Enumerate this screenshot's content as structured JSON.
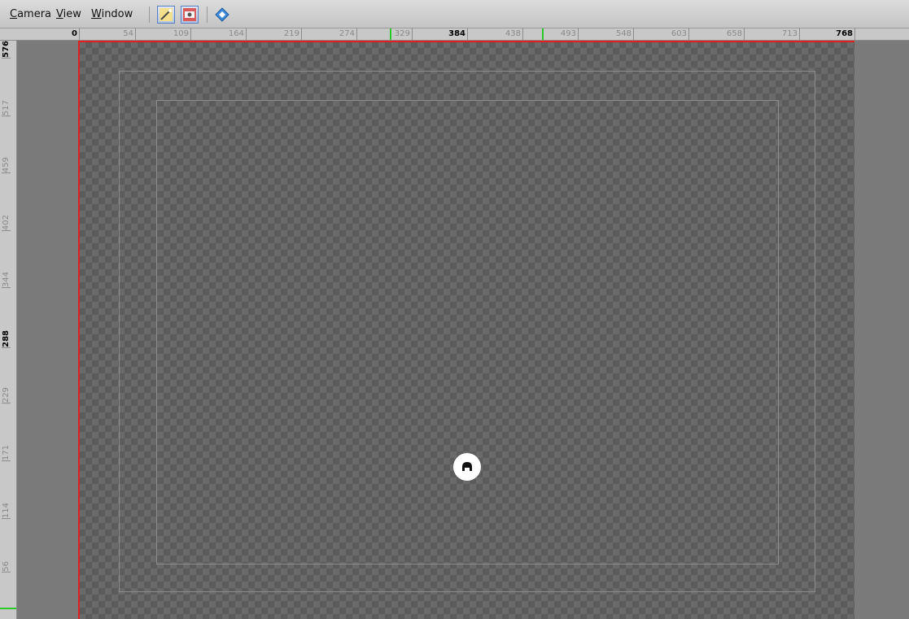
{
  "menu": {
    "camera": "Camera",
    "view": "View",
    "window": "Window"
  },
  "toolbar": {
    "buttons": [
      {
        "icon": "wand-icon",
        "active": true
      },
      {
        "icon": "camera-view-icon",
        "active": true
      },
      {
        "icon": "diamond-nav-icon",
        "active": false
      }
    ]
  },
  "ruler_h": {
    "ticks": [
      "0",
      "54",
      "109",
      "164",
      "219",
      "274",
      "329",
      "384",
      "438",
      "493",
      "548",
      "603",
      "658",
      "713",
      "768"
    ],
    "bold": [
      "0",
      "384",
      "768"
    ]
  },
  "ruler_v": {
    "ticks": [
      "576",
      "517",
      "459",
      "402",
      "344",
      "288",
      "229",
      "171",
      "114",
      "56"
    ],
    "bold": [
      "576",
      "288"
    ]
  },
  "colors": {
    "axis_red": "#e02020",
    "marker_green": "#29c929",
    "canvas_dark": "#5c5c5c",
    "canvas_light": "#6a6a6a"
  }
}
